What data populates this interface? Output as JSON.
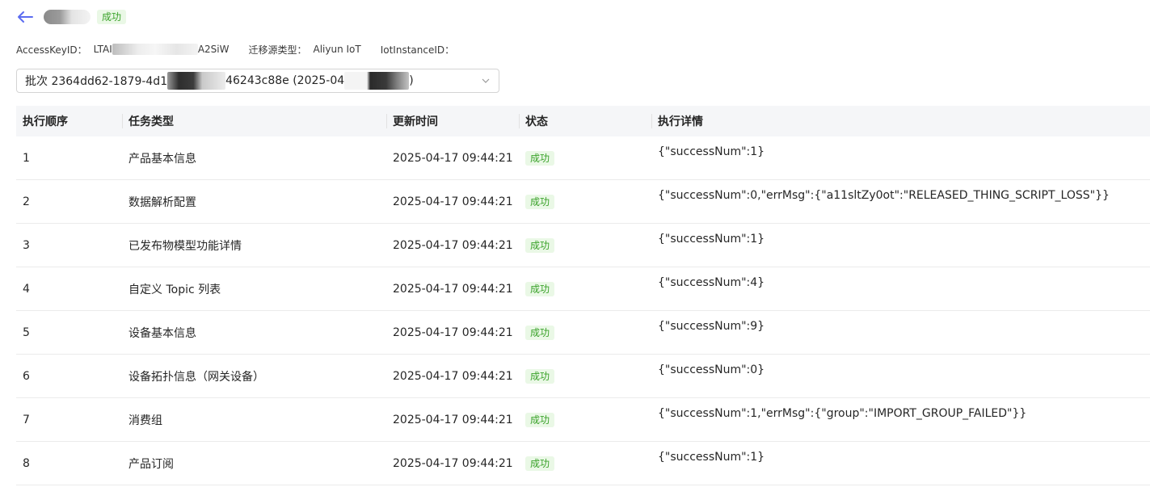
{
  "header": {
    "status": "成功"
  },
  "meta": {
    "access_key_label": "AccessKeyID：",
    "access_key_prefix": "LTAI",
    "access_key_suffix": "A2SiW",
    "source_type_label": "迁移源类型：",
    "source_type_value": "Aliyun IoT",
    "instance_label": "IotInstanceID："
  },
  "batch_select": {
    "prefix": "批次 2364dd62-1879-4d1",
    "middle": "46243c88e (2025-04",
    "suffix": ")"
  },
  "table": {
    "columns": [
      "执行顺序",
      "任务类型",
      "更新时间",
      "状态",
      "执行详情"
    ],
    "rows": [
      {
        "order": "1",
        "type": "产品基本信息",
        "time": "2025-04-17 09:44:21",
        "status": "成功",
        "detail": "{\"successNum\":1}"
      },
      {
        "order": "2",
        "type": "数据解析配置",
        "time": "2025-04-17 09:44:21",
        "status": "成功",
        "detail": "{\"successNum\":0,\"errMsg\":{\"a11sltZy0ot\":\"RELEASED_THING_SCRIPT_LOSS\"}}"
      },
      {
        "order": "3",
        "type": "已发布物模型功能详情",
        "time": "2025-04-17 09:44:21",
        "status": "成功",
        "detail": "{\"successNum\":1}"
      },
      {
        "order": "4",
        "type": "自定义 Topic 列表",
        "time": "2025-04-17 09:44:21",
        "status": "成功",
        "detail": "{\"successNum\":4}"
      },
      {
        "order": "5",
        "type": "设备基本信息",
        "time": "2025-04-17 09:44:21",
        "status": "成功",
        "detail": "{\"successNum\":9}"
      },
      {
        "order": "6",
        "type": "设备拓扑信息（网关设备）",
        "time": "2025-04-17 09:44:21",
        "status": "成功",
        "detail": "{\"successNum\":0}"
      },
      {
        "order": "7",
        "type": "消费组",
        "time": "2025-04-17 09:44:21",
        "status": "成功",
        "detail": "{\"successNum\":1,\"errMsg\":{\"group\":\"IMPORT_GROUP_FAILED\"}}"
      },
      {
        "order": "8",
        "type": "产品订阅",
        "time": "2025-04-17 09:44:21",
        "status": "成功",
        "detail": "{\"successNum\":1}"
      }
    ]
  },
  "colors": {
    "accent": "#5b6cf0",
    "success_bg": "#eaf8e6",
    "success_text": "#3aa22a",
    "header_bg": "#f5f6f8"
  }
}
